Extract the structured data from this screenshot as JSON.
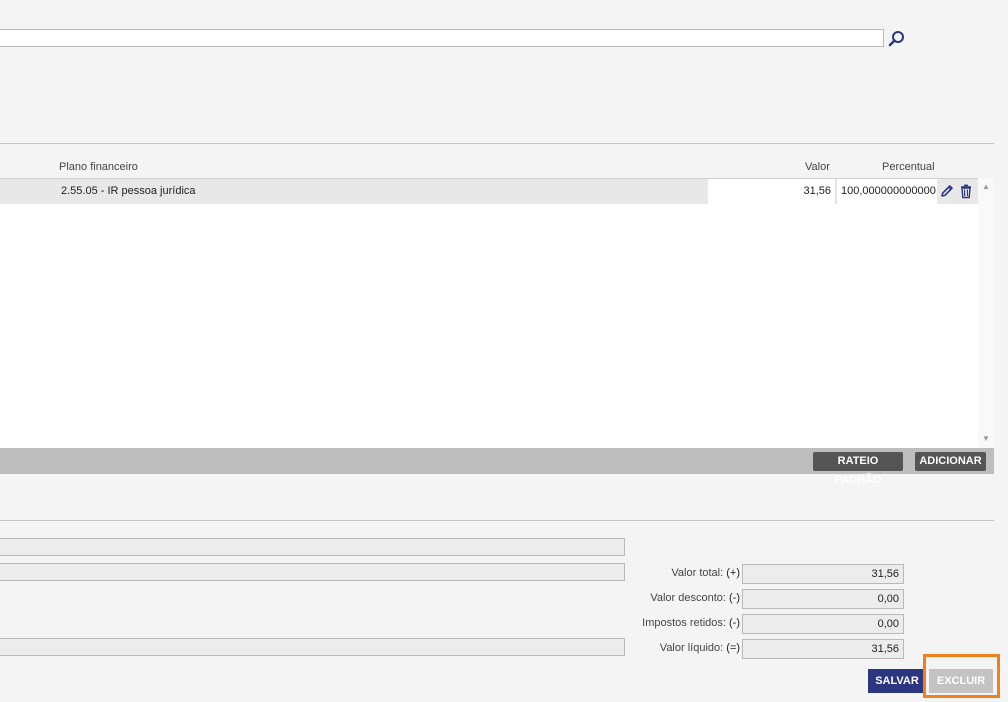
{
  "search": {
    "value": "",
    "icon": "search-icon"
  },
  "grid": {
    "columns": {
      "plan": "Plano financeiro",
      "valor": "Valor",
      "percentual": "Percentual"
    },
    "rows": [
      {
        "plan": "2.55.05 - IR pessoa jurídica",
        "valor": "31,56",
        "percentual": "100,000000000000"
      }
    ],
    "row_icons": [
      "edit-icon",
      "trash-icon"
    ]
  },
  "toolbar": {
    "rateio_label": "RATEIO PADRÃO",
    "adicionar_label": "ADICIONAR"
  },
  "totals": {
    "valor_total_label": "Valor total:",
    "valor_total_sign": "(+)",
    "valor_total": "31,56",
    "valor_desconto_label": "Valor desconto:",
    "valor_desconto_sign": "(-)",
    "valor_desconto": "0,00",
    "impostos_label": "Impostos retidos:",
    "impostos_sign": "(-)",
    "impostos": "0,00",
    "valor_liquido_label": "Valor líquido:",
    "valor_liquido_sign": "(=)",
    "valor_liquido": "31,56"
  },
  "actions": {
    "salvar_label": "SALVAR",
    "excluir_label": "EXCLUIR"
  },
  "colors": {
    "primary": "#2b3580",
    "disabled": "#c3c3c3",
    "highlight": "#f07f1e",
    "toolbar_button": "#545454",
    "icon": "#2b3580"
  }
}
